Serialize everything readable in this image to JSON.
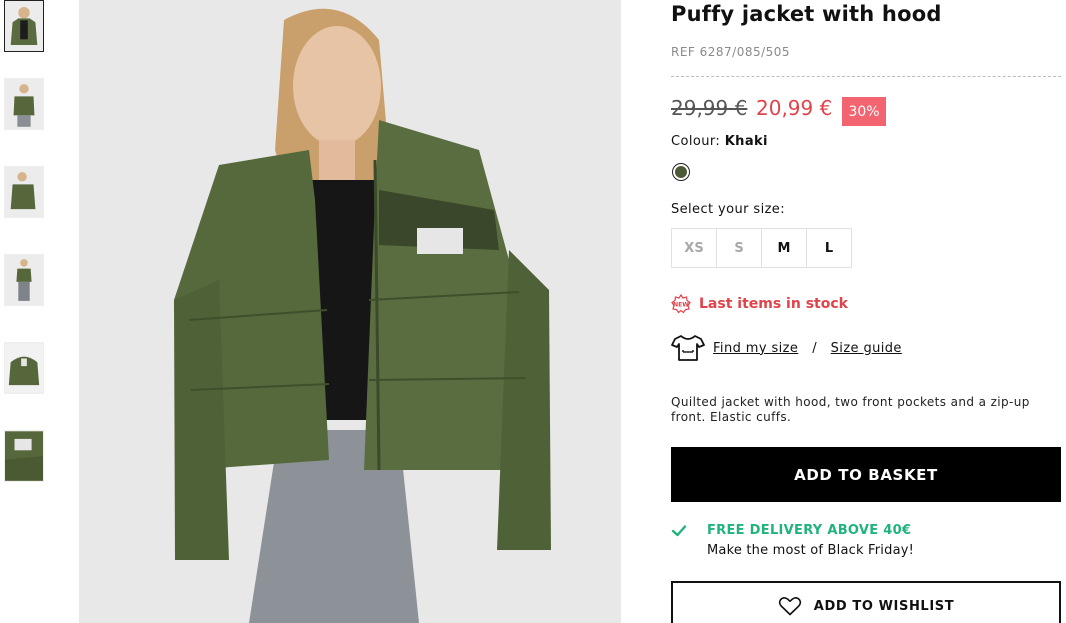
{
  "product": {
    "title": "Puffy jacket with hood",
    "ref": "REF 6287/085/505",
    "price_old": "29,99 €",
    "price_new": "20,99 €",
    "discount": "30%",
    "colour_label": "Colour:",
    "colour_value": "Khaki",
    "size_label": "Select your size:",
    "sizes": [
      {
        "label": "XS",
        "available": false
      },
      {
        "label": "S",
        "available": false
      },
      {
        "label": "M",
        "available": true
      },
      {
        "label": "L",
        "available": true
      }
    ],
    "stock_text": "Last items in stock",
    "find_my_size": "Find my size",
    "separator": "/",
    "size_guide": "Size guide",
    "description": "Quilted jacket with hood, two front pockets and a zip-up front. Elastic cuffs.",
    "add_to_basket": "ADD TO BASKET",
    "delivery_title": "FREE DELIVERY ABOVE 40€",
    "delivery_subtitle": "Make the most of Black Friday!",
    "wishlist": "ADD TO WISHLIST"
  },
  "gallery": {
    "thumbnail_count": 6,
    "active_index": 0
  },
  "colors": {
    "accent_red": "#e0434a",
    "discount_bg": "#f16470",
    "delivery_green": "#21b37c",
    "jacket_khaki": "#4c5a36"
  },
  "icons": [
    "new-badge-icon",
    "tshirt-icon",
    "check-icon",
    "heart-icon"
  ]
}
